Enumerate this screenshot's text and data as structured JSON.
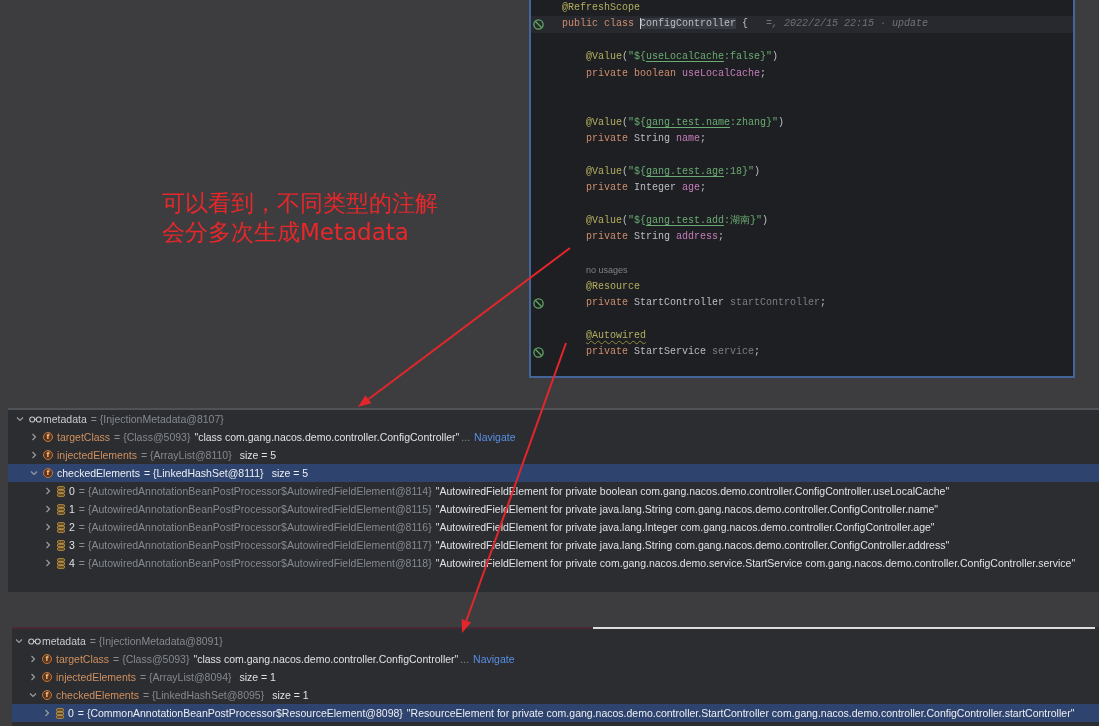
{
  "editor": {
    "lines": [
      {
        "kind": "code",
        "marker": false,
        "current": false,
        "tokens": [
          {
            "text": "@RefreshScope",
            "kind": "annotation"
          }
        ]
      },
      {
        "kind": "code",
        "marker": true,
        "current": true,
        "tokens": [
          {
            "text": "public class ",
            "kind": "keyword"
          },
          {
            "text": "ConfigController",
            "kind": "caret"
          },
          {
            "text": " {",
            "kind": "plain"
          }
        ],
        "hint": "=, 2022/2/15 22:15 · update",
        "children": [
          {
            "kind": "blank"
          },
          {
            "kind": "code",
            "marker": false,
            "current": false,
            "tokens": [
              {
                "text": "@Value",
                "kind": "annotation"
              },
              {
                "text": "(",
                "kind": "plain"
              },
              {
                "text": "\"${",
                "kind": "string"
              },
              {
                "text": "useLocalCache",
                "kind": "key"
              },
              {
                "text": ":false}\"",
                "kind": "string"
              },
              {
                "text": ")",
                "kind": "plain"
              }
            ]
          },
          {
            "kind": "code",
            "marker": false,
            "current": false,
            "tokens": [
              {
                "text": "private boolean ",
                "kind": "keyword"
              },
              {
                "text": "useLocalCache",
                "kind": "field"
              },
              {
                "text": ";",
                "kind": "plain"
              }
            ]
          },
          {
            "kind": "blank"
          },
          {
            "kind": "blank"
          },
          {
            "kind": "code",
            "marker": false,
            "current": false,
            "tokens": [
              {
                "text": "@Value",
                "kind": "annotation"
              },
              {
                "text": "(",
                "kind": "plain"
              },
              {
                "text": "\"${",
                "kind": "string"
              },
              {
                "text": "gang.test.name",
                "kind": "key"
              },
              {
                "text": ":zhang}\"",
                "kind": "string"
              },
              {
                "text": ")",
                "kind": "plain"
              }
            ]
          },
          {
            "kind": "code",
            "marker": false,
            "current": false,
            "tokens": [
              {
                "text": "private ",
                "kind": "keyword"
              },
              {
                "text": "String ",
                "kind": "plain"
              },
              {
                "text": "name",
                "kind": "field"
              },
              {
                "text": ";",
                "kind": "plain"
              }
            ]
          },
          {
            "kind": "blank"
          },
          {
            "kind": "code",
            "marker": false,
            "current": false,
            "tokens": [
              {
                "text": "@Value",
                "kind": "annotation"
              },
              {
                "text": "(",
                "kind": "plain"
              },
              {
                "text": "\"${",
                "kind": "string"
              },
              {
                "text": "gang.test.age",
                "kind": "key"
              },
              {
                "text": ":18}\"",
                "kind": "string"
              },
              {
                "text": ")",
                "kind": "plain"
              }
            ]
          },
          {
            "kind": "code",
            "marker": false,
            "current": false,
            "tokens": [
              {
                "text": "private ",
                "kind": "keyword"
              },
              {
                "text": "Integer ",
                "kind": "plain"
              },
              {
                "text": "age",
                "kind": "field"
              },
              {
                "text": ";",
                "kind": "plain"
              }
            ]
          },
          {
            "kind": "blank"
          },
          {
            "kind": "code",
            "marker": false,
            "current": false,
            "tokens": [
              {
                "text": "@Value",
                "kind": "annotation"
              },
              {
                "text": "(",
                "kind": "plain"
              },
              {
                "text": "\"${",
                "kind": "string"
              },
              {
                "text": "gang.test.add",
                "kind": "key"
              },
              {
                "text": ":湖南}\"",
                "kind": "string"
              },
              {
                "text": ")",
                "kind": "plain"
              }
            ]
          },
          {
            "kind": "code",
            "marker": false,
            "current": false,
            "tokens": [
              {
                "text": "private ",
                "kind": "keyword"
              },
              {
                "text": "String ",
                "kind": "plain"
              },
              {
                "text": "address",
                "kind": "field"
              },
              {
                "text": ";",
                "kind": "plain"
              }
            ]
          },
          {
            "kind": "blank"
          },
          {
            "kind": "hint",
            "text": "no usages"
          },
          {
            "kind": "code",
            "marker": false,
            "current": false,
            "tokens": [
              {
                "text": "@Resource",
                "kind": "annotation"
              }
            ]
          },
          {
            "kind": "code",
            "marker": true,
            "current": false,
            "tokens": [
              {
                "text": "private ",
                "kind": "keyword"
              },
              {
                "text": "StartController ",
                "kind": "plain"
              },
              {
                "text": "startController",
                "kind": "unused"
              },
              {
                "text": ";",
                "kind": "plain"
              }
            ]
          },
          {
            "kind": "blank"
          },
          {
            "kind": "code",
            "marker": false,
            "current": false,
            "tokens": [
              {
                "text": "@Autowired",
                "kind": "warning"
              }
            ]
          },
          {
            "kind": "code",
            "marker": true,
            "current": false,
            "tokens": [
              {
                "text": "private ",
                "kind": "keyword"
              },
              {
                "text": "StartService ",
                "kind": "plain"
              },
              {
                "text": "service",
                "kind": "unused"
              },
              {
                "text": ";",
                "kind": "plain"
              }
            ]
          }
        ]
      }
    ]
  },
  "note": {
    "lines": [
      "可以看到，不同类型的注解",
      "会分多次生成Metadata"
    ]
  },
  "debug_panels": [
    {
      "nodes": [
        {
          "kind": "object",
          "name": "metadata",
          "ref": "= {InjectionMetadata@8107}",
          "expanded": true,
          "selected": false,
          "children": [
            {
              "kind": "field",
              "badge": "f",
              "name": "targetClass",
              "ref": "= {Class@5093}",
              "value": "\"class com.gang.nacos.demo.controller.ConfigController\"",
              "more": "...",
              "link": "Navigate",
              "expanded": false,
              "selected": false
            },
            {
              "kind": "field",
              "badge": "f",
              "name": "injectedElements",
              "ref": "= {ArrayList@8110}",
              "size": "size = 5",
              "expanded": false,
              "selected": false
            },
            {
              "kind": "field",
              "badge": "f",
              "name": "checkedElements",
              "ref": "= {LinkedHashSet@8111}",
              "size": "size = 5",
              "expanded": true,
              "selected": true,
              "children": [
                {
                  "kind": "element",
                  "name": "0",
                  "ref": "= {AutowiredAnnotationBeanPostProcessor$AutowiredFieldElement@8114}",
                  "value": "\"AutowiredFieldElement for private boolean com.gang.nacos.demo.controller.ConfigController.useLocalCache\"",
                  "expanded": false,
                  "selected": false
                },
                {
                  "kind": "element",
                  "name": "1",
                  "ref": "= {AutowiredAnnotationBeanPostProcessor$AutowiredFieldElement@8115}",
                  "value": "\"AutowiredFieldElement for private java.lang.String com.gang.nacos.demo.controller.ConfigController.name\"",
                  "expanded": false,
                  "selected": false
                },
                {
                  "kind": "element",
                  "name": "2",
                  "ref": "= {AutowiredAnnotationBeanPostProcessor$AutowiredFieldElement@8116}",
                  "value": "\"AutowiredFieldElement for private java.lang.Integer com.gang.nacos.demo.controller.ConfigController.age\"",
                  "expanded": false,
                  "selected": false
                },
                {
                  "kind": "element",
                  "name": "3",
                  "ref": "= {AutowiredAnnotationBeanPostProcessor$AutowiredFieldElement@8117}",
                  "value": "\"AutowiredFieldElement for private java.lang.String com.gang.nacos.demo.controller.ConfigController.address\"",
                  "expanded": false,
                  "selected": false
                },
                {
                  "kind": "element",
                  "name": "4",
                  "ref": "= {AutowiredAnnotationBeanPostProcessor$AutowiredFieldElement@8118}",
                  "value": "\"AutowiredFieldElement for private com.gang.nacos.demo.service.StartService com.gang.nacos.demo.controller.ConfigController.service\"",
                  "expanded": false,
                  "selected": false
                }
              ]
            }
          ]
        }
      ]
    },
    {
      "nodes": [
        {
          "kind": "object",
          "name": "metadata",
          "ref": "= {InjectionMetadata@8091}",
          "expanded": true,
          "selected": false,
          "children": [
            {
              "kind": "field",
              "badge": "f",
              "name": "targetClass",
              "ref": "= {Class@5093}",
              "value": "\"class com.gang.nacos.demo.controller.ConfigController\"",
              "more": "...",
              "link": "Navigate",
              "expanded": false,
              "selected": false
            },
            {
              "kind": "field",
              "badge": "f",
              "name": "injectedElements",
              "ref": "= {ArrayList@8094}",
              "size": "size = 1",
              "expanded": false,
              "selected": false
            },
            {
              "kind": "field",
              "badge": "f",
              "name": "checkedElements",
              "ref": "= {LinkedHashSet@8095}",
              "size": "size = 1",
              "expanded": true,
              "selected": false,
              "children": [
                {
                  "kind": "element",
                  "name": "0",
                  "ref": "= {CommonAnnotationBeanPostProcessor$ResourceElement@8098}",
                  "value": "\"ResourceElement for private com.gang.nacos.demo.controller.StartController com.gang.nacos.demo.controller.ConfigController.startController\"",
                  "expanded": false,
                  "selected": true
                }
              ]
            }
          ]
        }
      ]
    }
  ]
}
